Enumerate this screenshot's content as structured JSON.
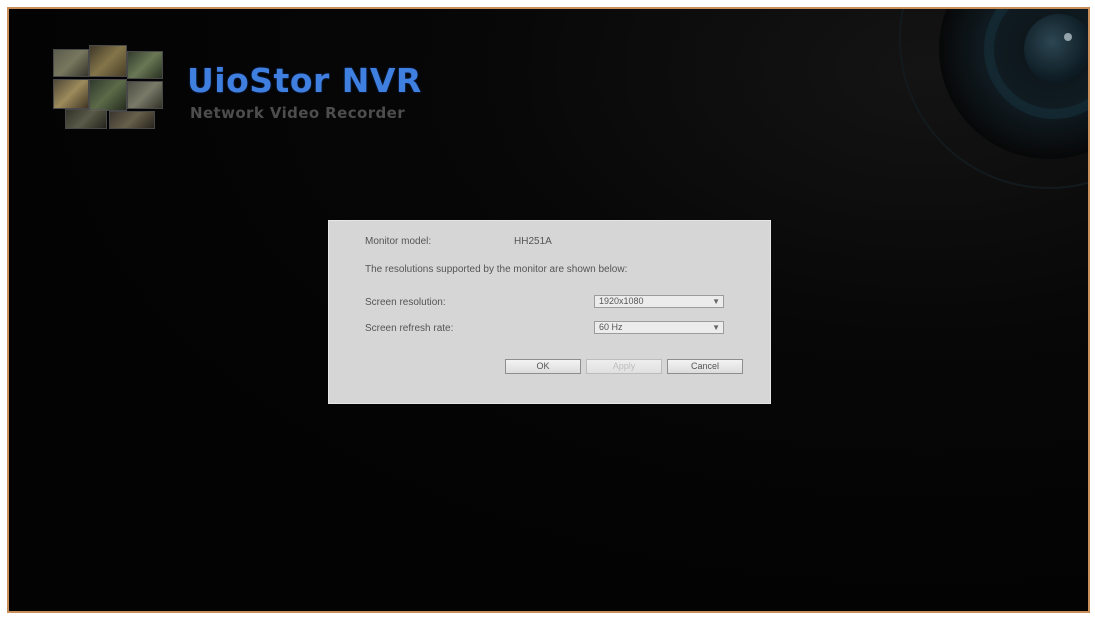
{
  "branding": {
    "title": "UioStor NVR",
    "subtitle": "Network Video Recorder",
    "logo_icon": "camera-thumbnails-icon",
    "lens_icon": "camera-lens-icon",
    "title_color": "#3f7fe0"
  },
  "dialog": {
    "monitor_model_label": "Monitor model:",
    "monitor_model_value": "HH251A",
    "info_text": "The resolutions supported by the monitor are shown below:",
    "resolution_label": "Screen resolution:",
    "resolution_value": "1920x1080",
    "refresh_label": "Screen refresh rate:",
    "refresh_value": "60 Hz",
    "dropdown_icon": "chevron-down-icon",
    "ok_label": "OK",
    "apply_label": "Apply",
    "cancel_label": "Cancel"
  }
}
